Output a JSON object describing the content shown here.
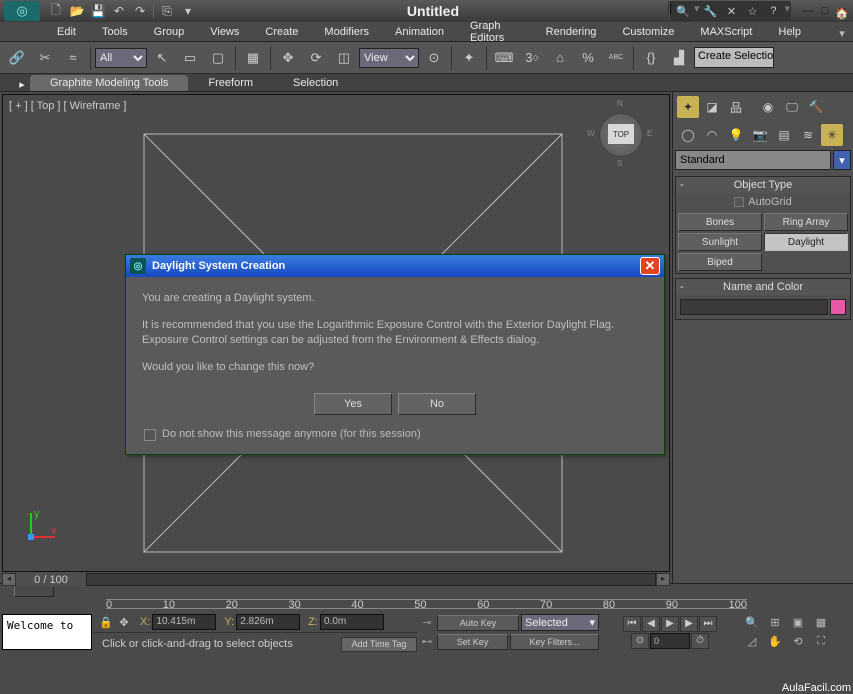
{
  "title": "Untitled",
  "menubar": [
    "Edit",
    "Tools",
    "Group",
    "Views",
    "Create",
    "Modifiers",
    "Animation",
    "Graph Editors",
    "Rendering",
    "Customize",
    "MAXScript",
    "Help"
  ],
  "toolbar": {
    "all_label": "All",
    "view_label": "View",
    "end_field": "Create Selection S"
  },
  "ribbon": {
    "tabs": [
      "Graphite Modeling Tools",
      "Freeform",
      "Selection"
    ]
  },
  "viewport": {
    "label": "[ + ] [ Top ] [ Wireframe ]",
    "cube": "TOP",
    "compass": {
      "n": "N",
      "e": "E",
      "s": "S",
      "w": "W"
    }
  },
  "slider": {
    "pages": "0 / 100"
  },
  "rpanel": {
    "standard": "Standard",
    "obj_type": "Object Type",
    "autogrid": "AutoGrid",
    "buttons": [
      "Bones",
      "Ring Array",
      "Sunlight",
      "Daylight",
      "Biped"
    ],
    "name_color": "Name and Color"
  },
  "dialog": {
    "title": "Daylight System Creation",
    "p1": "You are creating a Daylight system.",
    "p2": "It is recommended that you use the Logarithmic Exposure Control with the Exterior Daylight Flag. Exposure Control settings can be adjusted from the Environment & Effects dialog.",
    "p3": "Would you like to change this now?",
    "yes": "Yes",
    "no": "No",
    "dontshow": "Do not show this message anymore (for this session)"
  },
  "timeline": {
    "ticks": [
      "0",
      "10",
      "20",
      "30",
      "40",
      "50",
      "60",
      "70",
      "80",
      "90",
      "100"
    ]
  },
  "status": {
    "welcome": "Welcome to",
    "x_lab": "X:",
    "y_lab": "Y:",
    "z_lab": "Z:",
    "x": "10.415m",
    "y": "2.826m",
    "z": "0.0m",
    "prompt": "Click or click-and-drag to select objects",
    "addtime": "Add Time Tag",
    "autokey": "Auto Key",
    "setkey": "Set Key",
    "selected": "Selected",
    "keyfilters": "Key Filters...",
    "tcurrent": "0"
  },
  "watermark": "AulaFacil.com"
}
